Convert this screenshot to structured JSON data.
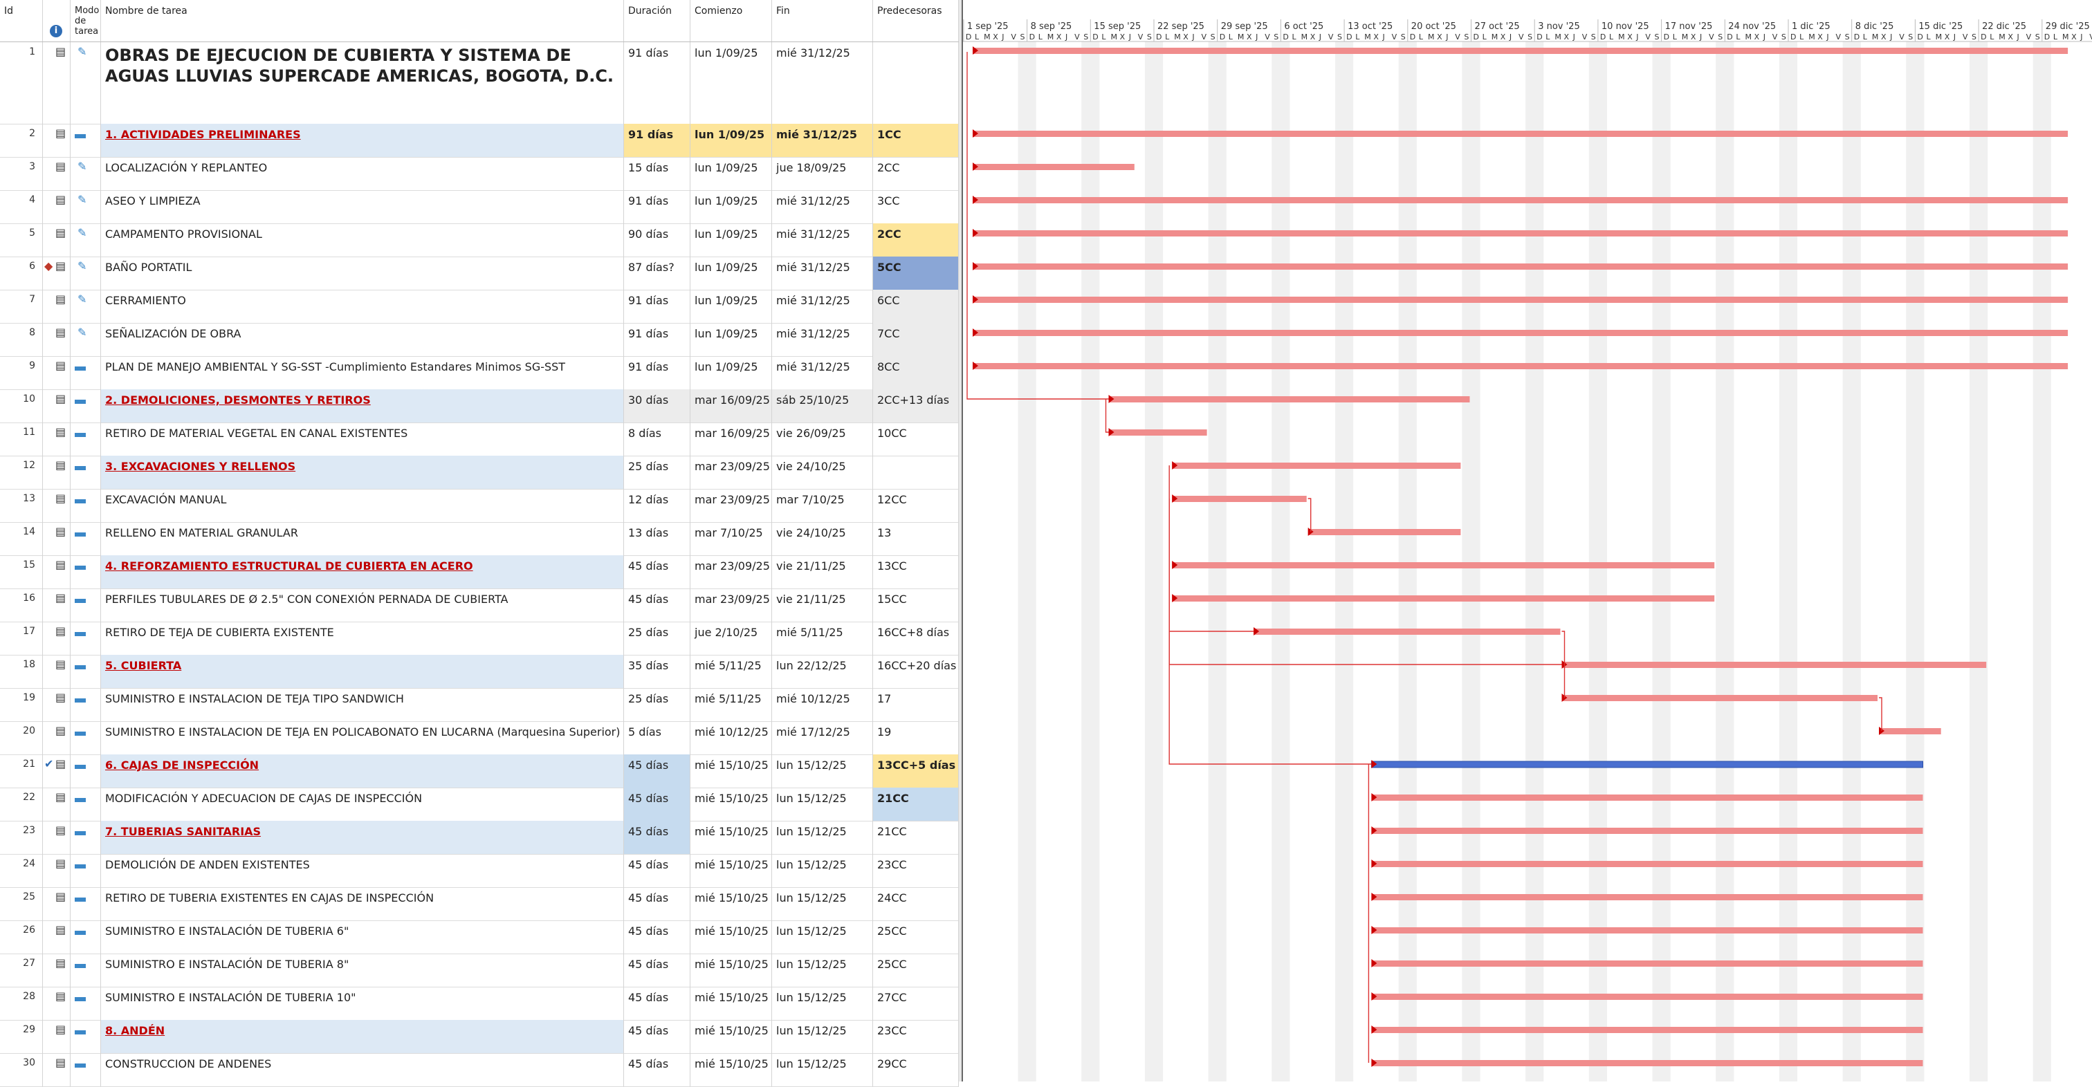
{
  "columns": {
    "id": "Id",
    "mode": "Modo de tarea",
    "name": "Nombre de tarea",
    "duration": "Duración",
    "start": "Comienzo",
    "finish": "Fin",
    "predecessors": "Predecesoras"
  },
  "timescale": {
    "weeks": [
      "1 sep '25",
      "8 sep '25",
      "15 sep '25",
      "22 sep '25",
      "29 sep '25",
      "6 oct '25",
      "13 oct '25",
      "20 oct '25",
      "27 oct '25",
      "3 nov '25",
      "10 nov '25",
      "17 nov '25",
      "24 nov '25",
      "1 dic '25",
      "8 dic '25",
      "15 dic '25",
      "22 dic '25",
      "29 dic '25"
    ],
    "day_letters": [
      "D",
      "L",
      "M",
      "X",
      "J",
      "V",
      "S"
    ]
  },
  "tasks": [
    {
      "id": "1",
      "name": "OBRAS DE EJECUCION DE CUBIERTA Y SISTEMA DE AGUAS LLUVIAS SUPERCADE AMERICAS, BOGOTA, D.C.",
      "duration": "91 días",
      "start": "lun 1/09/25",
      "finish": "mié 31/12/25",
      "pred": "",
      "type": "project",
      "mode": "pin",
      "s": 0,
      "d": 121
    },
    {
      "id": "2",
      "name": "1. ACTIVIDADES PRELIMINARES",
      "duration": "91 días",
      "start": "lun 1/09/25",
      "finish": "mié 31/12/25",
      "pred": "1CC",
      "type": "summary",
      "mode": "auto",
      "s": 0,
      "d": 121,
      "hl": "yellow-all"
    },
    {
      "id": "3",
      "name": "LOCALIZACIÓN Y REPLANTEO",
      "duration": "15 días",
      "start": "lun 1/09/25",
      "finish": "jue 18/09/25",
      "pred": "2CC",
      "type": "task",
      "mode": "pin",
      "s": 0,
      "d": 18
    },
    {
      "id": "4",
      "name": "ASEO Y LIMPIEZA",
      "duration": "91 días",
      "start": "lun 1/09/25",
      "finish": "mié 31/12/25",
      "pred": "3CC",
      "type": "task",
      "mode": "pin",
      "s": 0,
      "d": 121
    },
    {
      "id": "5",
      "name": "CAMPAMENTO PROVISIONAL",
      "duration": "90 días",
      "start": "lun 1/09/25",
      "finish": "mié 31/12/25",
      "pred": "2CC",
      "type": "task",
      "mode": "pin",
      "s": 0,
      "d": 121,
      "hl": "pred-yellow"
    },
    {
      "id": "6",
      "name": "BAÑO PORTATIL",
      "duration": "87 días?",
      "start": "lun 1/09/25",
      "finish": "mié 31/12/25",
      "pred": "5CC",
      "type": "task",
      "mode": "pin",
      "s": 0,
      "d": 121,
      "hl": "pred-blue",
      "warn": true
    },
    {
      "id": "7",
      "name": "CERRAMIENTO",
      "duration": "91 días",
      "start": "lun 1/09/25",
      "finish": "mié 31/12/25",
      "pred": "6CC",
      "type": "task",
      "mode": "pin",
      "s": 0,
      "d": 121,
      "hl": "pred-grey"
    },
    {
      "id": "8",
      "name": "SEÑALIZACIÓN DE OBRA",
      "duration": "91 días",
      "start": "lun 1/09/25",
      "finish": "mié 31/12/25",
      "pred": "7CC",
      "type": "task",
      "mode": "pin",
      "s": 0,
      "d": 121,
      "hl": "pred-grey"
    },
    {
      "id": "9",
      "name": "PLAN DE MANEJO AMBIENTAL Y SG-SST -Cumplimiento Estandares Minimos SG-SST",
      "duration": "91 días",
      "start": "lun 1/09/25",
      "finish": "mié 31/12/25",
      "pred": "8CC",
      "type": "task",
      "mode": "auto",
      "s": 0,
      "d": 121,
      "hl": "pred-grey"
    },
    {
      "id": "10",
      "name": "2. DEMOLICIONES, DESMONTES Y RETIROS",
      "duration": "30 días",
      "start": "mar 16/09/25",
      "finish": "sáb 25/10/25",
      "pred": "2CC+13 días",
      "type": "summary",
      "mode": "auto",
      "s": 15,
      "d": 40,
      "hl": "grey-all"
    },
    {
      "id": "11",
      "name": "RETIRO DE MATERIAL VEGETAL EN CANAL EXISTENTES",
      "duration": "8 días",
      "start": "mar 16/09/25",
      "finish": "vie 26/09/25",
      "pred": "10CC",
      "type": "task",
      "mode": "auto",
      "s": 15,
      "d": 11
    },
    {
      "id": "12",
      "name": "3. EXCAVACIONES Y RELLENOS",
      "duration": "25 días",
      "start": "mar 23/09/25",
      "finish": "vie 24/10/25",
      "pred": "",
      "type": "summary",
      "mode": "auto",
      "s": 22,
      "d": 32
    },
    {
      "id": "13",
      "name": "EXCAVACIÓN MANUAL",
      "duration": "12 días",
      "start": "mar 23/09/25",
      "finish": "mar 7/10/25",
      "pred": "12CC",
      "type": "task",
      "mode": "auto",
      "s": 22,
      "d": 15
    },
    {
      "id": "14",
      "name": "RELLENO EN MATERIAL GRANULAR",
      "duration": "13 días",
      "start": "mar 7/10/25",
      "finish": "vie 24/10/25",
      "pred": "13",
      "type": "task",
      "mode": "auto",
      "s": 37,
      "d": 17
    },
    {
      "id": "15",
      "name": "4. REFORZAMIENTO ESTRUCTURAL DE CUBIERTA EN ACERO",
      "duration": "45 días",
      "start": "mar 23/09/25",
      "finish": "vie 21/11/25",
      "pred": "13CC",
      "type": "summary",
      "mode": "auto",
      "s": 22,
      "d": 60
    },
    {
      "id": "16",
      "name": "PERFILES TUBULARES DE Ø 2.5\" CON CONEXIÓN PERNADA DE CUBIERTA",
      "duration": "45 días",
      "start": "mar 23/09/25",
      "finish": "vie 21/11/25",
      "pred": "15CC",
      "type": "task",
      "mode": "auto",
      "s": 22,
      "d": 60
    },
    {
      "id": "17",
      "name": "RETIRO DE TEJA DE CUBIERTA EXISTENTE",
      "duration": "25 días",
      "start": "jue 2/10/25",
      "finish": "mié 5/11/25",
      "pred": "16CC+8 días",
      "type": "task",
      "mode": "auto",
      "s": 31,
      "d": 34
    },
    {
      "id": "18",
      "name": "5. CUBIERTA",
      "duration": "35 días",
      "start": "mié 5/11/25",
      "finish": "lun 22/12/25",
      "pred": "16CC+20 días",
      "type": "summary",
      "mode": "auto",
      "s": 65,
      "d": 47
    },
    {
      "id": "19",
      "name": "SUMINISTRO E INSTALACION DE TEJA TIPO SANDWICH",
      "duration": "25 días",
      "start": "mié 5/11/25",
      "finish": "mié 10/12/25",
      "pred": "17",
      "type": "task",
      "mode": "auto",
      "s": 65,
      "d": 35
    },
    {
      "id": "20",
      "name": "SUMINISTRO E INSTALACION DE TEJA EN POLICABONATO EN LUCARNA (Marquesina Superior)",
      "duration": "5 días",
      "start": "mié 10/12/25",
      "finish": "mié 17/12/25",
      "pred": "19",
      "type": "task",
      "mode": "auto",
      "s": 100,
      "d": 7
    },
    {
      "id": "21",
      "name": "6. CAJAS DE INSPECCIÓN",
      "duration": "45 días",
      "start": "mié 15/10/25",
      "finish": "lun 15/12/25",
      "pred": "13CC+5 días",
      "type": "summary",
      "mode": "auto",
      "s": 44,
      "d": 61,
      "hl": "sel-yellow",
      "done": true
    },
    {
      "id": "22",
      "name": "MODIFICACIÓN Y ADECUACION DE CAJAS DE INSPECCIÓN",
      "duration": "45 días",
      "start": "mié 15/10/25",
      "finish": "lun 15/12/25",
      "pred": "21CC",
      "type": "task",
      "mode": "auto",
      "s": 44,
      "d": 61,
      "hl": "sel-blue"
    },
    {
      "id": "23",
      "name": "7. TUBERIAS SANITARIAS",
      "duration": "45 días",
      "start": "mié 15/10/25",
      "finish": "lun 15/12/25",
      "pred": "21CC",
      "type": "summary",
      "mode": "auto",
      "s": 44,
      "d": 61,
      "hl": "dur-blue"
    },
    {
      "id": "24",
      "name": "DEMOLICIÓN DE ANDEN EXISTENTES",
      "duration": "45 días",
      "start": "mié 15/10/25",
      "finish": "lun 15/12/25",
      "pred": "23CC",
      "type": "task",
      "mode": "auto",
      "s": 44,
      "d": 61
    },
    {
      "id": "25",
      "name": "RETIRO DE TUBERIA EXISTENTES EN CAJAS DE INSPECCIÓN",
      "duration": "45 días",
      "start": "mié 15/10/25",
      "finish": "lun 15/12/25",
      "pred": "24CC",
      "type": "task",
      "mode": "auto",
      "s": 44,
      "d": 61
    },
    {
      "id": "26",
      "name": "SUMINISTRO E INSTALACIÓN DE TUBERIA 6\"",
      "duration": "45 días",
      "start": "mié 15/10/25",
      "finish": "lun 15/12/25",
      "pred": "25CC",
      "type": "task",
      "mode": "auto",
      "s": 44,
      "d": 61
    },
    {
      "id": "27",
      "name": "SUMINISTRO E INSTALACIÓN DE TUBERIA 8\"",
      "duration": "45 días",
      "start": "mié 15/10/25",
      "finish": "lun 15/12/25",
      "pred": "25CC",
      "type": "task",
      "mode": "auto",
      "s": 44,
      "d": 61
    },
    {
      "id": "28",
      "name": "SUMINISTRO E INSTALACIÓN DE TUBERIA 10\"",
      "duration": "45 días",
      "start": "mié 15/10/25",
      "finish": "lun 15/12/25",
      "pred": "27CC",
      "type": "task",
      "mode": "auto",
      "s": 44,
      "d": 61
    },
    {
      "id": "29",
      "name": "8. ANDÉN",
      "duration": "45 días",
      "start": "mié 15/10/25",
      "finish": "lun 15/12/25",
      "pred": "23CC",
      "type": "summary",
      "mode": "auto",
      "s": 44,
      "d": 61
    },
    {
      "id": "30",
      "name": "CONSTRUCCION DE ANDENES",
      "duration": "45 días",
      "start": "mié 15/10/25",
      "finish": "lun 15/12/25",
      "pred": "29CC",
      "type": "task",
      "mode": "auto",
      "s": 44,
      "d": 61
    }
  ],
  "colors": {
    "bar": "#f08c8c",
    "selected_bar": "#4a6fd0",
    "link": "#d33"
  }
}
